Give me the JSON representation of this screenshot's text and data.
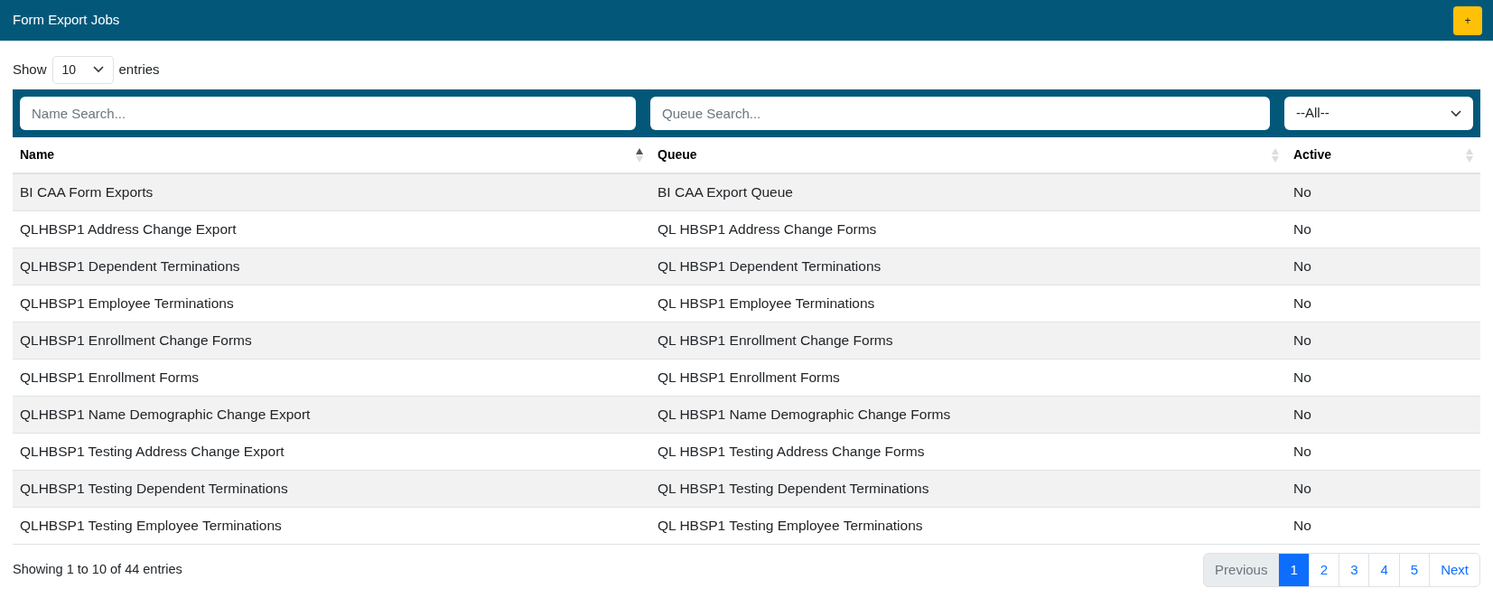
{
  "header": {
    "title": "Form Export Jobs",
    "add_button": "+"
  },
  "length_menu": {
    "label_before": "Show",
    "value": "10",
    "label_after": "entries"
  },
  "filters": {
    "name_placeholder": "Name Search...",
    "queue_placeholder": "Queue Search...",
    "active_value": "--All--"
  },
  "table": {
    "columns": [
      {
        "label": "Name",
        "sorted_ascending": true
      },
      {
        "label": "Queue",
        "sorted_ascending": false
      },
      {
        "label": "Active",
        "sorted_ascending": false
      }
    ],
    "rows": [
      [
        "BI CAA Form Exports",
        "BI CAA Export Queue",
        "No"
      ],
      [
        "QLHBSP1 Address Change Export",
        "QL HBSP1 Address Change Forms",
        "No"
      ],
      [
        "QLHBSP1 Dependent Terminations",
        "QL HBSP1 Dependent Terminations",
        "No"
      ],
      [
        "QLHBSP1 Employee Terminations",
        "QL HBSP1 Employee Terminations",
        "No"
      ],
      [
        "QLHBSP1 Enrollment Change Forms",
        "QL HBSP1 Enrollment Change Forms",
        "No"
      ],
      [
        "QLHBSP1 Enrollment Forms",
        "QL HBSP1 Enrollment Forms",
        "No"
      ],
      [
        "QLHBSP1 Name Demographic Change Export",
        "QL HBSP1 Name Demographic Change Forms",
        "No"
      ],
      [
        "QLHBSP1 Testing Address Change Export",
        "QL HBSP1 Testing Address Change Forms",
        "No"
      ],
      [
        "QLHBSP1 Testing Dependent Terminations",
        "QL HBSP1 Testing Dependent Terminations",
        "No"
      ],
      [
        "QLHBSP1 Testing Employee Terminations",
        "QL HBSP1 Testing Employee Terminations",
        "No"
      ]
    ]
  },
  "info": "Showing 1 to 10 of 44 entries",
  "pagination": [
    {
      "label": "Previous",
      "selected": false,
      "disabled": true
    },
    {
      "label": "1",
      "selected": true,
      "disabled": false
    },
    {
      "label": "2",
      "selected": false,
      "disabled": false
    },
    {
      "label": "3",
      "selected": false,
      "disabled": false
    },
    {
      "label": "4",
      "selected": false,
      "disabled": false
    },
    {
      "label": "5",
      "selected": false,
      "disabled": false
    },
    {
      "label": "Next",
      "selected": false,
      "disabled": false
    }
  ]
}
